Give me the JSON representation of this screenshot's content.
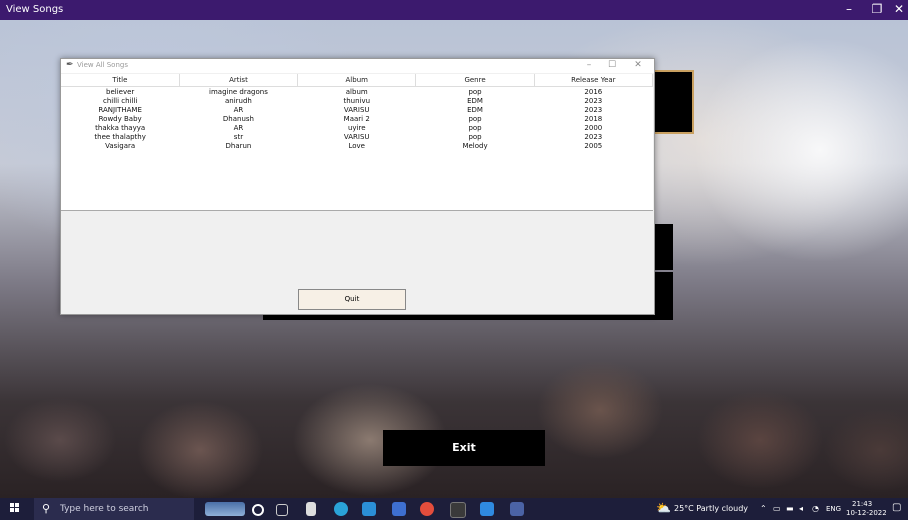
{
  "app": {
    "title": "View Songs",
    "controls": [
      "–",
      "❐",
      "✕"
    ]
  },
  "child_window": {
    "title": "View All Songs",
    "controls": [
      "–",
      "☐",
      "✕"
    ],
    "columns": [
      "Title",
      "Artist",
      "Album",
      "Genre",
      "Release Year"
    ],
    "rows": [
      [
        "believer",
        "imagine dragons",
        "album",
        "pop",
        "2016"
      ],
      [
        "chilli chilli",
        "anirudh",
        "thunivu",
        "EDM",
        "2023"
      ],
      [
        "RANJITHAME",
        "AR",
        "VARISU",
        "EDM",
        "2023"
      ],
      [
        "Rowdy Baby",
        "Dhanush",
        "Maari 2",
        "pop",
        "2018"
      ],
      [
        "thakka thayya",
        "AR",
        "uyire",
        "pop",
        "2000"
      ],
      [
        "thee thalapthy",
        "str",
        "VARISU",
        "pop",
        "2023"
      ],
      [
        "Vasigara",
        "Dharun",
        "Love",
        "Melody",
        "2005"
      ]
    ],
    "quit_label": "Quit"
  },
  "exit_label": "Exit",
  "taskbar": {
    "search_placeholder": "Type here to search",
    "weather": "25°C  Partly cloudy",
    "language": "ENG",
    "time": "21:43",
    "date": "10-12-2022"
  }
}
